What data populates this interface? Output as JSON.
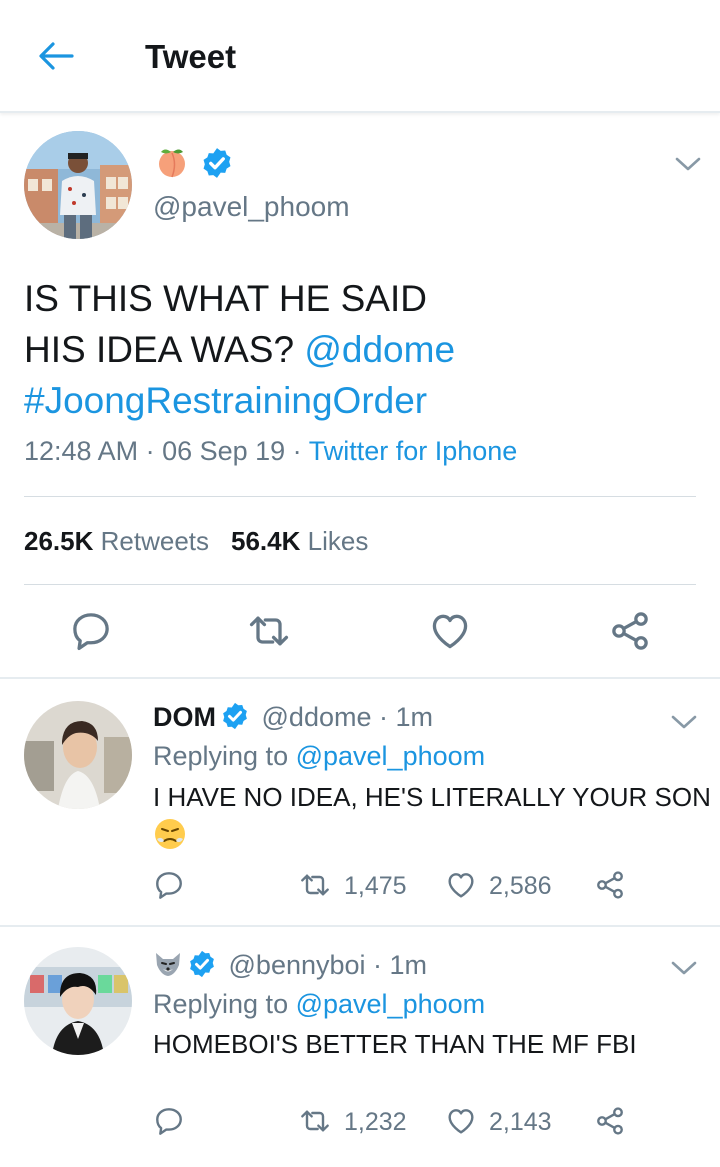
{
  "topbar": {
    "title": "Tweet"
  },
  "main_tweet": {
    "display_name_emoji": "🍑",
    "handle": "@pavel_phoom",
    "text_line1": "IS THIS WHAT HE SAID",
    "text_line2_plain": "HIS IDEA WAS? ",
    "text_line2_mention": "@ddome",
    "hashtag": "#JoongRestrainingOrder",
    "time": "12:48 AM · 06 Sep 19 · ",
    "source": "Twitter for Iphone",
    "retweets_count": "26.5K",
    "retweets_label": "Retweets",
    "likes_count": "56.4K",
    "likes_label": "Likes"
  },
  "replies": [
    {
      "name": "DOM",
      "handle": "@ddome · 1m",
      "replying_prefix": "Replying to ",
      "replying_to": "@pavel_phoom",
      "text": "I HAVE NO IDEA, HE'S LITERALLY YOUR SON",
      "emoji": "😤",
      "retweets": "1,475",
      "likes": "2,586"
    },
    {
      "name_emoji": "🐺",
      "handle": "@bennyboi · 1m",
      "replying_prefix": "Replying to ",
      "replying_to": "@pavel_phoom",
      "text": "HOMEBOI'S BETTER THAN THE MF FBI",
      "retweets": "1,232",
      "likes": "2,143"
    }
  ],
  "colors": {
    "accent": "#1b95e0",
    "text": "#14171a",
    "muted": "#657786",
    "divider": "#e6ecf0"
  },
  "icons": [
    "back-arrow-icon",
    "chevron-down-icon",
    "verified-badge-icon",
    "reply-icon",
    "retweet-icon",
    "like-icon",
    "share-icon"
  ]
}
